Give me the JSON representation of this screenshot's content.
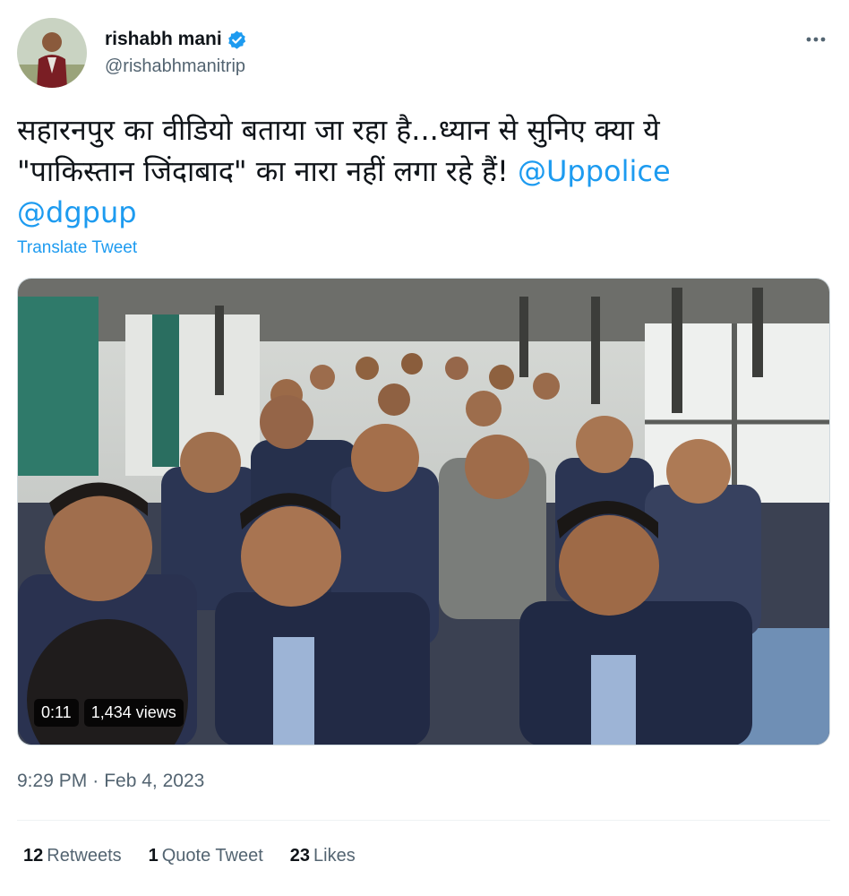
{
  "author": {
    "display_name": "rishabh mani",
    "handle": "@rishabhmanitrip",
    "verified": true,
    "avatar_icon": "profile-photo"
  },
  "tweet": {
    "text_line1": "सहारनपुर का वीडियो बताया जा रहा है...ध्यान से सुनिए क्या ये",
    "text_line2": "\"पाकिस्तान जिंदाबाद\" का नारा नहीं लगा रहे हैं! ",
    "mention1": "@Uppolice",
    "mention2": "@dgpup",
    "translate_label": "Translate Tweet"
  },
  "media": {
    "duration": "0:11",
    "views": "1,434 views"
  },
  "meta": {
    "time": "9:29 PM",
    "separator": "·",
    "date": "Feb 4, 2023"
  },
  "stats": {
    "retweets_count": "12",
    "retweets_label": "Retweets",
    "quotes_count": "1",
    "quotes_label": "Quote Tweet",
    "likes_count": "23",
    "likes_label": "Likes"
  },
  "colors": {
    "accent": "#1d9bf0",
    "muted": "#536471",
    "text": "#0f1419"
  }
}
